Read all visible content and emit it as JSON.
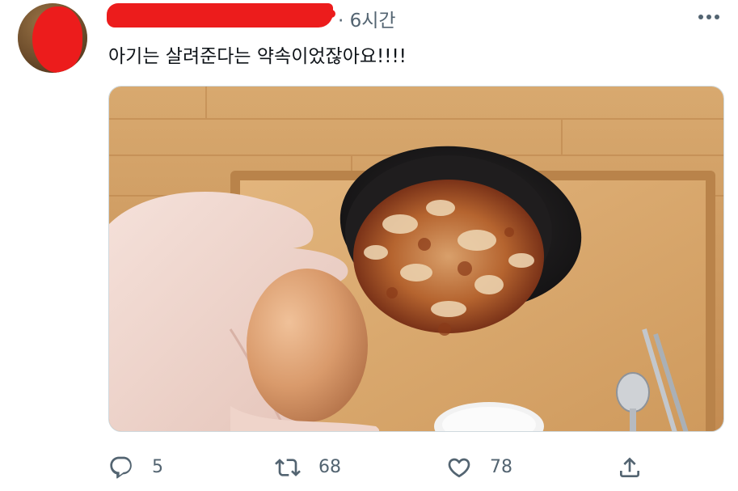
{
  "tweet": {
    "time": "· 6시간",
    "text": "아기는 살려준다는 약속이었잖아요!!!!",
    "redaction_color": "#ec1c1c"
  },
  "actions": {
    "reply_count": "5",
    "retweet_count": "68",
    "like_count": "78"
  },
  "icons": {
    "more": "more-icon",
    "reply": "reply-icon",
    "retweet": "retweet-icon",
    "like": "heart-icon",
    "share": "share-icon"
  },
  "colors": {
    "text": "#0f1419",
    "secondary": "#536471"
  }
}
